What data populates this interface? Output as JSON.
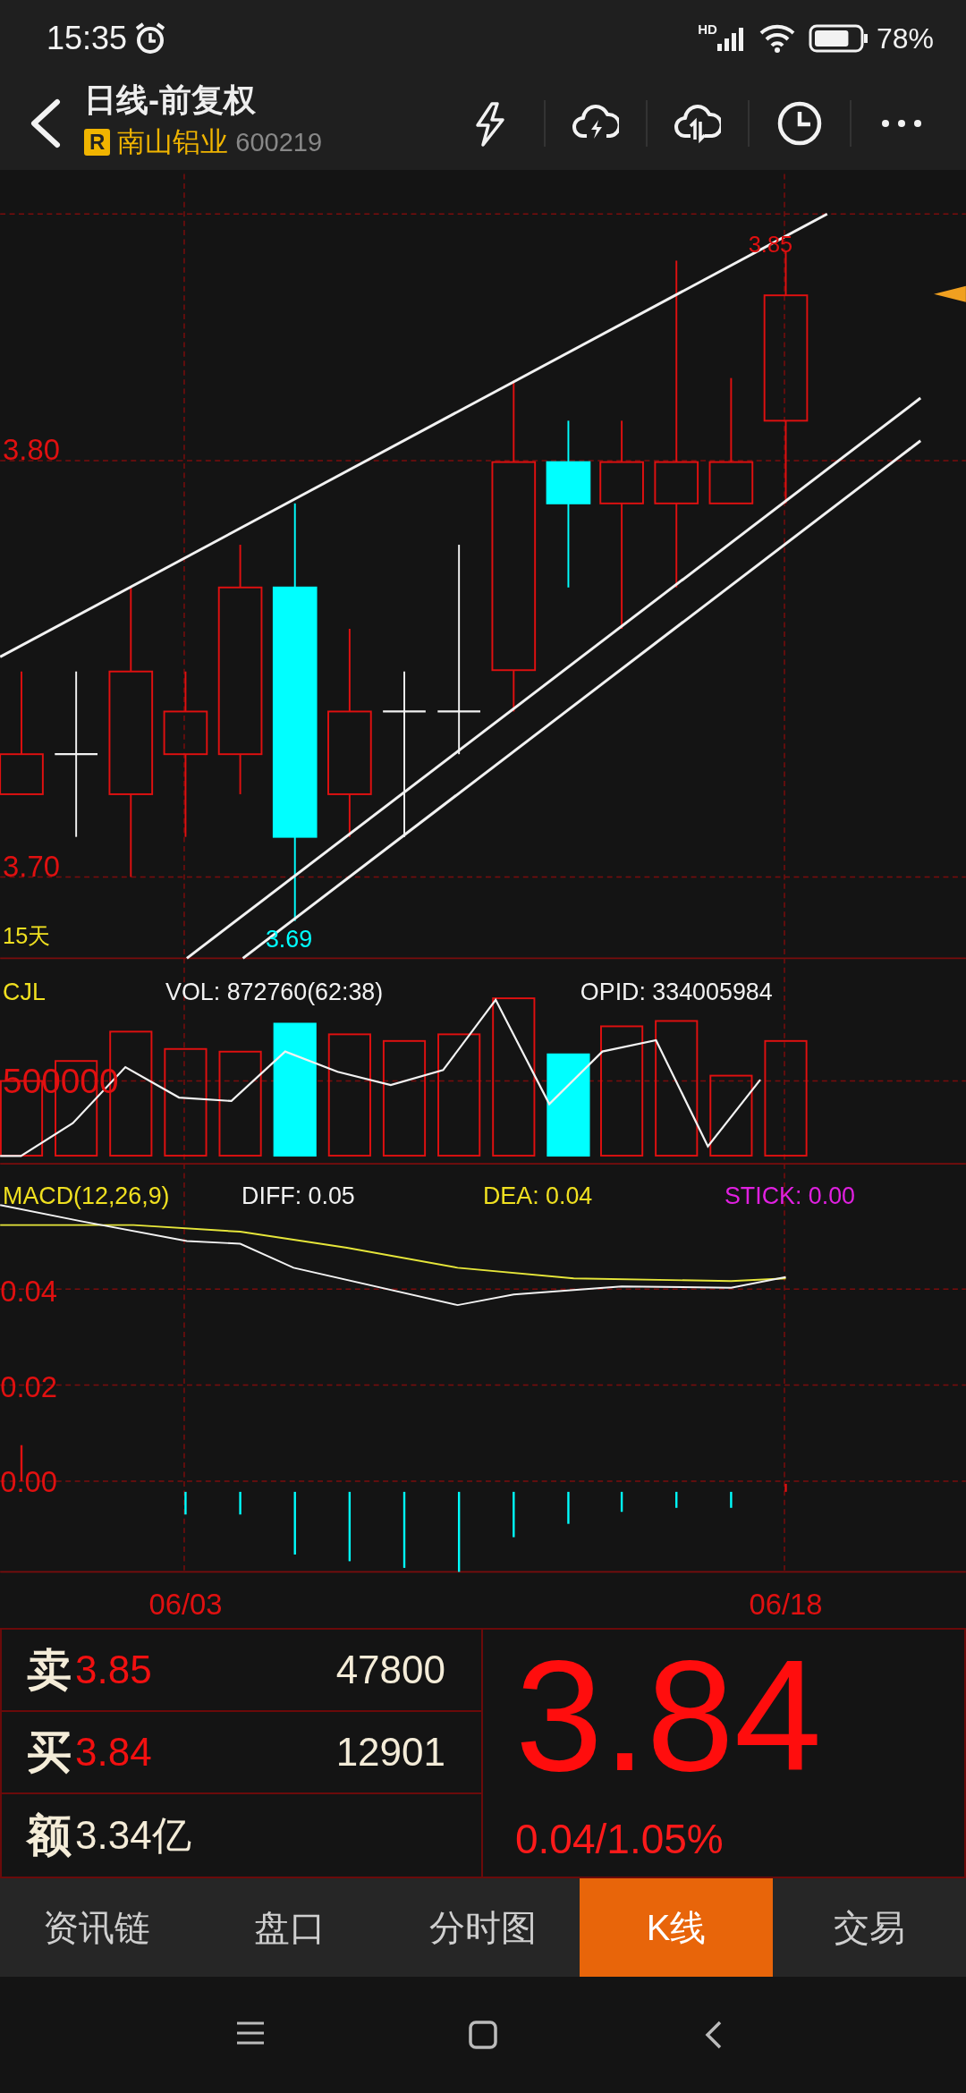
{
  "status_bar": {
    "time": "15:35",
    "network": "HD",
    "battery": "78%"
  },
  "header": {
    "title": "日线-前复权",
    "badge": "R",
    "stock_name": "南山铝业",
    "stock_code": "600219"
  },
  "kline": {
    "high_label": "3.85",
    "price_labels": [
      "3.80",
      "3.70"
    ],
    "period": "15天",
    "low_label": "3.69"
  },
  "volume": {
    "name": "CJL",
    "vol": "VOL: 872760(62:38)",
    "opid": "OPID: 334005984",
    "axis_label": "500000"
  },
  "macd": {
    "name": "MACD(12,26,9)",
    "diff": "DIFF: 0.05",
    "dea": "DEA: 0.04",
    "stick": "STICK: 0.00",
    "axis_labels": [
      "0.04",
      "0.02",
      "0.00"
    ]
  },
  "dates": [
    "06/03",
    "06/18"
  ],
  "quote": {
    "rows": [
      {
        "kind": "sell",
        "label": "卖",
        "price": "3.85",
        "volume": "47800"
      },
      {
        "kind": "buy",
        "label": "买",
        "price": "3.84",
        "volume": "12901"
      },
      {
        "kind": "amount",
        "label": "额",
        "value": "3.34亿"
      }
    ],
    "price": "3.84",
    "change": "0.04/1.05%"
  },
  "tabs": [
    {
      "label": "资讯链",
      "selected": false
    },
    {
      "label": "盘口",
      "selected": false
    },
    {
      "label": "分时图",
      "selected": false
    },
    {
      "label": "K线",
      "selected": true
    },
    {
      "label": "交易",
      "selected": false
    }
  ]
}
